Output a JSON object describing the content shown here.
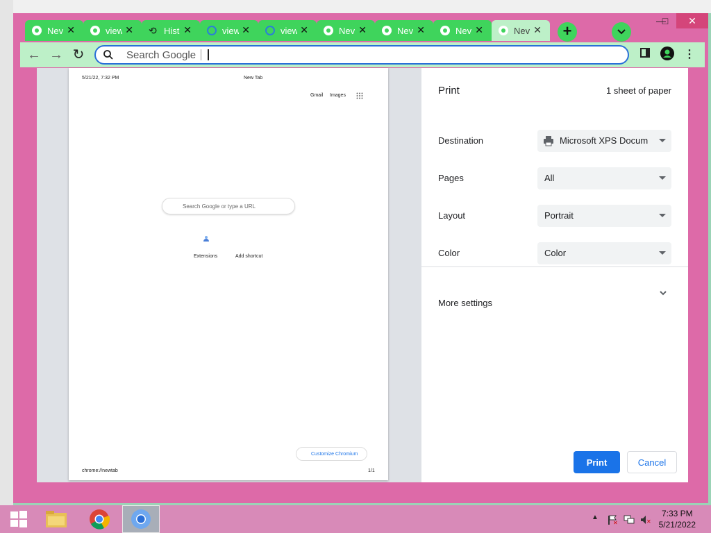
{
  "window": {
    "controls": {
      "minimize": "—",
      "maximize": "□",
      "close": "✕"
    }
  },
  "tabs": [
    {
      "title": "Nev",
      "icon": "chrome-icon",
      "active": false
    },
    {
      "title": "view",
      "icon": "chrome-icon",
      "active": false
    },
    {
      "title": "Hist",
      "icon": "history-icon",
      "active": false
    },
    {
      "title": "view",
      "icon": "extension-icon",
      "active": false
    },
    {
      "title": "view",
      "icon": "extension-icon",
      "active": false
    },
    {
      "title": "Nev",
      "icon": "chrome-icon",
      "active": false
    },
    {
      "title": "Nev",
      "icon": "chrome-icon",
      "active": false
    },
    {
      "title": "Nev",
      "icon": "chrome-icon",
      "active": false
    },
    {
      "title": "Nev",
      "icon": "chrome-icon",
      "active": true
    }
  ],
  "toolbar": {
    "omnibox_text": "Search Google"
  },
  "print_preview": {
    "header_date": "5/21/22, 7:32 PM",
    "header_title": "New Tab",
    "links": {
      "gmail": "Gmail",
      "images": "Images"
    },
    "search_placeholder": "Search Google or type a URL",
    "shortcuts": {
      "extensions": "Extensions",
      "add": "Add shortcut"
    },
    "customize": "Customize Chromium",
    "footer_url": "chrome://newtab",
    "footer_page": "1/1"
  },
  "print_settings": {
    "title": "Print",
    "sheets": "1 sheet of paper",
    "fields": [
      {
        "label": "Destination",
        "value": "Microsoft XPS Docum"
      },
      {
        "label": "Pages",
        "value": "All"
      },
      {
        "label": "Layout",
        "value": "Portrait"
      },
      {
        "label": "Color",
        "value": "Color"
      }
    ],
    "more_settings": "More settings",
    "print_button": "Print",
    "cancel_button": "Cancel"
  },
  "taskbar": {
    "time": "7:33 PM",
    "date": "5/21/2022"
  },
  "colors": {
    "tab_green": "#3fd45c",
    "frame_pink": "#dd6aa8",
    "accent_blue": "#1a73e8"
  }
}
